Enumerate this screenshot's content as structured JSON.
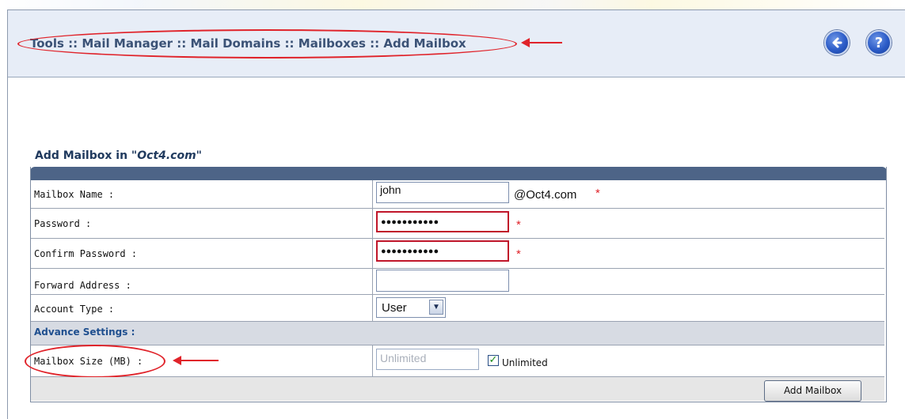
{
  "header": {
    "breadcrumb": "Tools :: Mail Manager :: Mail Domains :: Mailboxes :: Add Mailbox",
    "back_icon": "back-arrow-icon",
    "help_icon": "help-icon"
  },
  "form": {
    "title_prefix": "Add Mailbox in ",
    "domain_quoted": "\"Oct4.com\"",
    "fields": {
      "mailbox_name": {
        "label": "Mailbox Name :",
        "value": "john",
        "suffix": "@Oct4.com",
        "required": "*"
      },
      "password": {
        "label": "Password :",
        "value": "●●●●●●●●●●●",
        "required": "*"
      },
      "confirm_password": {
        "label": "Confirm Password :",
        "value": "●●●●●●●●●●●",
        "required": "*"
      },
      "forward_address": {
        "label": "Forward Address :",
        "value": ""
      },
      "account_type": {
        "label": "Account Type :",
        "selected": "User"
      }
    },
    "advance_settings": {
      "heading": "Advance Settings :",
      "mailbox_size": {
        "label": "Mailbox Size (MB) :",
        "placeholder": "Unlimited",
        "checkbox_label": "Unlimited",
        "checked": true
      }
    },
    "submit_label": "Add Mailbox"
  },
  "colors": {
    "accent": "#e0232a",
    "header_bg": "#e7edf7",
    "title": "#3b5276"
  }
}
